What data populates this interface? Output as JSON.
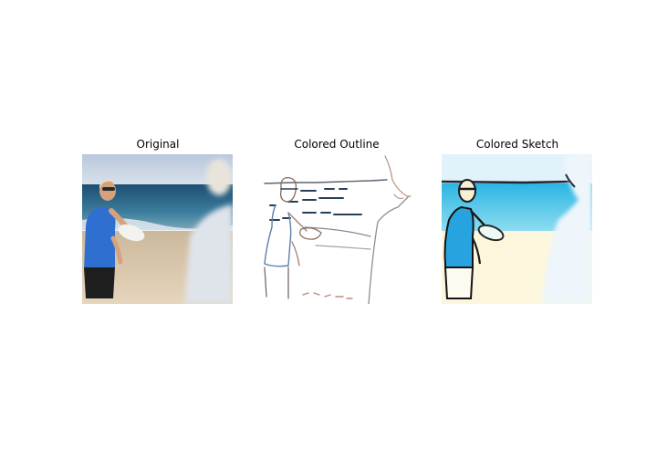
{
  "panels": [
    {
      "title": "Original",
      "image": "beach-frisbee-photo"
    },
    {
      "title": "Colored Outline",
      "image": "beach-frisbee-outline"
    },
    {
      "title": "Colored Sketch",
      "image": "beach-frisbee-sketch"
    }
  ],
  "colors": {
    "sky": "#c9d6e6",
    "sea": "#2f6f92",
    "sand": "#d9c7ad",
    "shirt": "#2f6fd0",
    "sketch_sea": "#48c4e8",
    "sketch_sand": "#fdf6dc"
  }
}
